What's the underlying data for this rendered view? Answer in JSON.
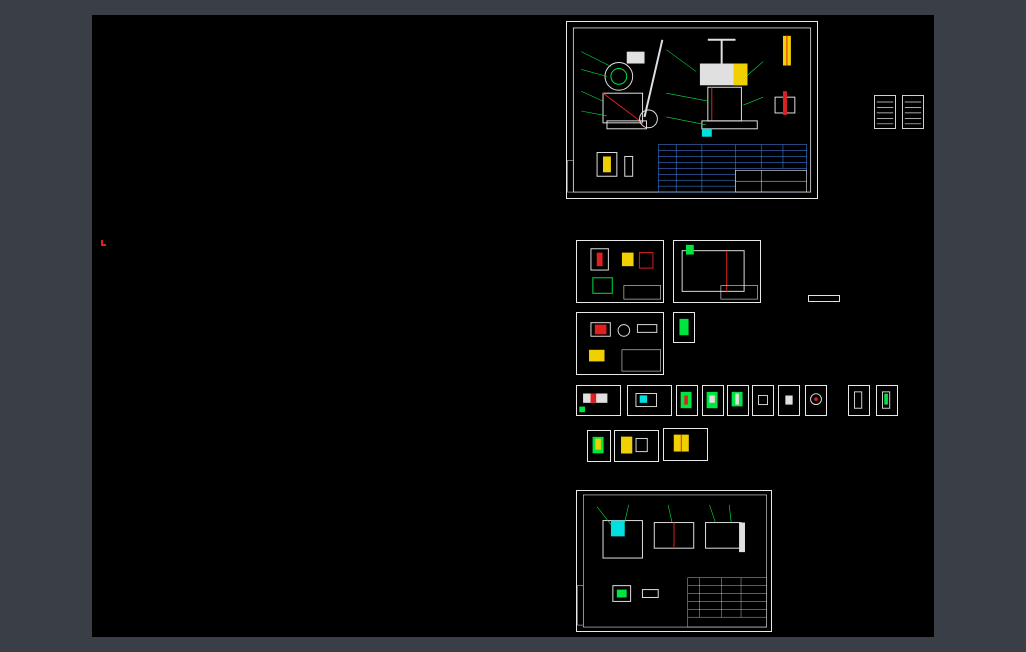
{
  "window": {
    "background": "#3a3f47"
  },
  "canvas": {
    "background": "#000000"
  },
  "colors": {
    "border": "#e8e8e8",
    "leader": "#00e640",
    "geometry": "#e0e0e0",
    "accent_red": "#e02020",
    "accent_yellow": "#f0d000",
    "accent_cyan": "#00e0e0",
    "table_blue": "#4a90ff"
  },
  "icons": {
    "ucs": "ucs-icon"
  }
}
